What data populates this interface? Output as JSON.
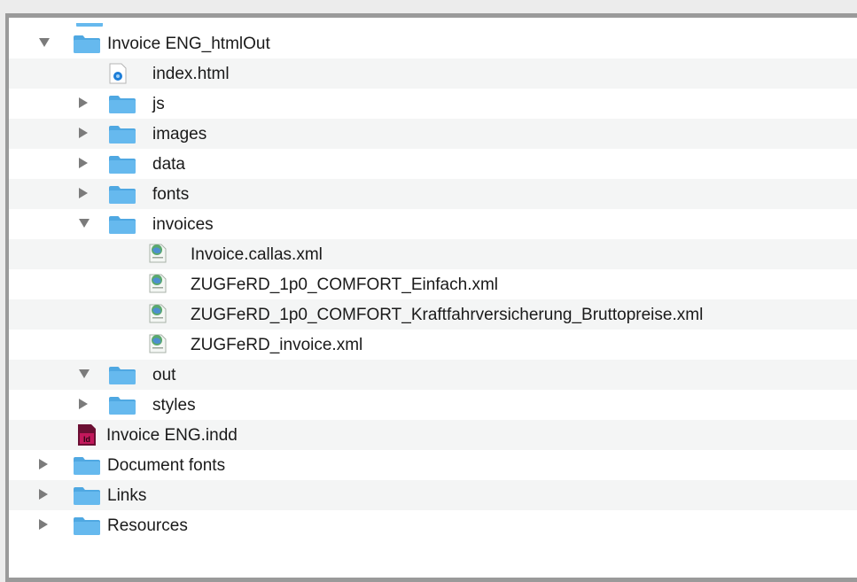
{
  "tree": {
    "rows": [
      {
        "label": "Invoice ENG_htmlOut",
        "depth": 0,
        "kind": "folder",
        "expand": "down",
        "icon": "folder-icon"
      },
      {
        "label": "index.html",
        "depth": 1,
        "kind": "html",
        "expand": "none",
        "icon": "html-file-icon"
      },
      {
        "label": "js",
        "depth": 1,
        "kind": "folder",
        "expand": "right",
        "icon": "folder-icon"
      },
      {
        "label": "images",
        "depth": 1,
        "kind": "folder",
        "expand": "right",
        "icon": "folder-icon"
      },
      {
        "label": "data",
        "depth": 1,
        "kind": "folder",
        "expand": "right",
        "icon": "folder-icon"
      },
      {
        "label": "fonts",
        "depth": 1,
        "kind": "folder",
        "expand": "right",
        "icon": "folder-icon"
      },
      {
        "label": "invoices",
        "depth": 1,
        "kind": "folder",
        "expand": "down",
        "icon": "folder-icon"
      },
      {
        "label": "Invoice.callas.xml",
        "depth": 2,
        "kind": "xml",
        "expand": "none",
        "icon": "xml-file-icon"
      },
      {
        "label": "ZUGFeRD_1p0_COMFORT_Einfach.xml",
        "depth": 2,
        "kind": "xml",
        "expand": "none",
        "icon": "xml-file-icon"
      },
      {
        "label": "ZUGFeRD_1p0_COMFORT_Kraftfahrversicherung_Bruttopreise.xml",
        "depth": 2,
        "kind": "xml",
        "expand": "none",
        "icon": "xml-file-icon"
      },
      {
        "label": "ZUGFeRD_invoice.xml",
        "depth": 2,
        "kind": "xml",
        "expand": "none",
        "icon": "xml-file-icon"
      },
      {
        "label": "out",
        "depth": 1,
        "kind": "folder",
        "expand": "down",
        "icon": "folder-icon"
      },
      {
        "label": "styles",
        "depth": 1,
        "kind": "folder",
        "expand": "right",
        "icon": "folder-icon"
      },
      {
        "label": "Invoice ENG.indd",
        "depth": 0,
        "kind": "indd",
        "expand": "none",
        "icon": "indesign-file-icon"
      },
      {
        "label": "Document fonts",
        "depth": -1,
        "kind": "folder",
        "expand": "right",
        "icon": "folder-icon"
      },
      {
        "label": "Links",
        "depth": -1,
        "kind": "folder",
        "expand": "right",
        "icon": "folder-icon"
      },
      {
        "label": "Resources",
        "depth": -1,
        "kind": "folder",
        "expand": "right",
        "icon": "folder-icon"
      }
    ]
  },
  "colors": {
    "folder": "#66b9ee",
    "folder_tab": "#4fa8e2",
    "alt_row": "#f4f5f5",
    "disclosure": "#7b7b7b",
    "indesign": "#c2185b"
  }
}
